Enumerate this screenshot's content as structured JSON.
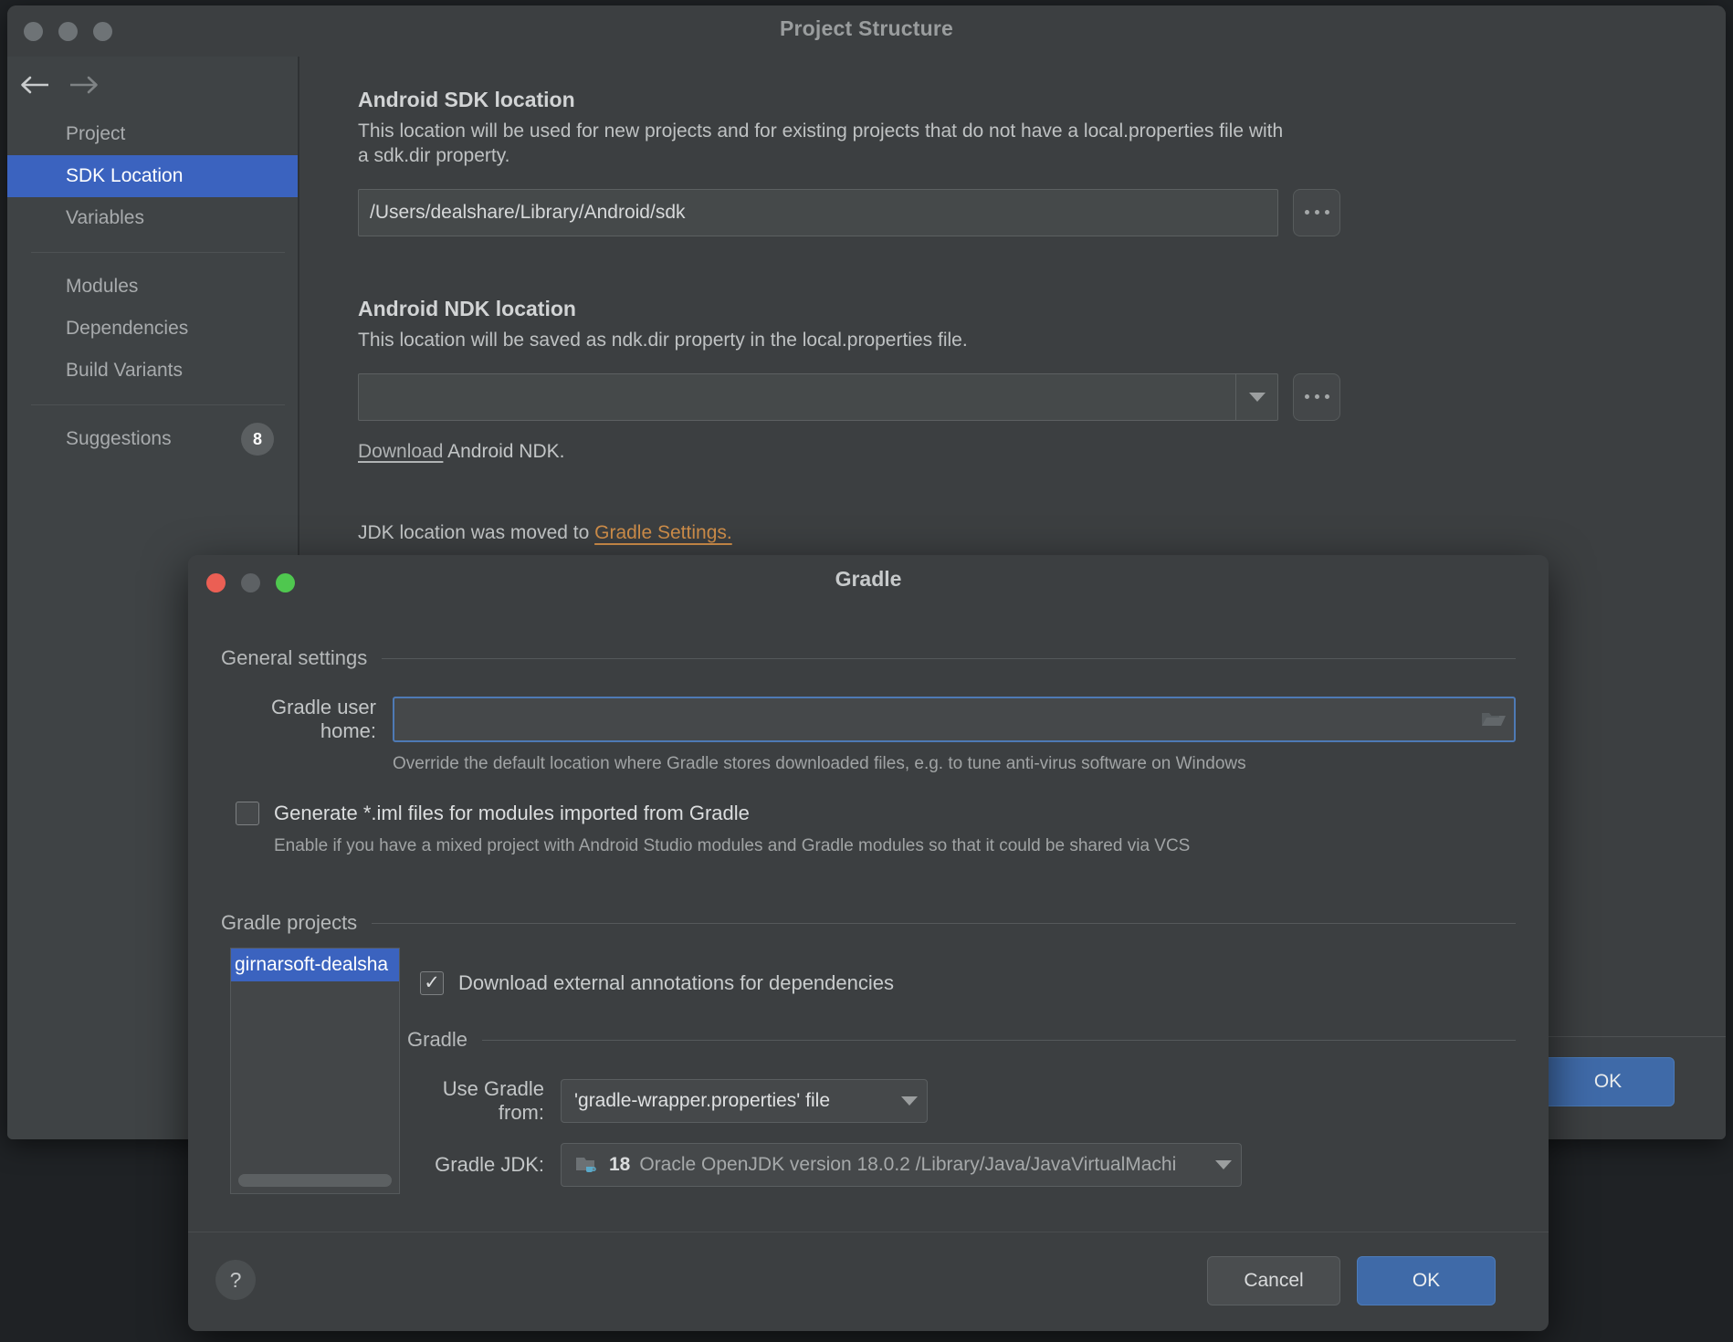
{
  "project_structure": {
    "title": "Project Structure",
    "sidebar": {
      "back_icon": "arrow-left-icon",
      "forward_icon": "arrow-right-icon",
      "items": [
        {
          "label": "Project",
          "selected": false
        },
        {
          "label": "SDK Location",
          "selected": true
        },
        {
          "label": "Variables",
          "selected": false
        },
        {
          "label": "Modules",
          "selected": false
        },
        {
          "label": "Dependencies",
          "selected": false
        },
        {
          "label": "Build Variants",
          "selected": false
        }
      ],
      "suggestions_label": "Suggestions",
      "suggestions_count": "8"
    },
    "sdk_section": {
      "title": "Android SDK location",
      "description": "This location will be used for new projects and for existing projects that do not have a local.properties file with a sdk.dir property.",
      "value": "/Users/dealshare/Library/Android/sdk",
      "browse_label": "...",
      "browse_icon": "ellipsis-icon"
    },
    "ndk_section": {
      "title": "Android NDK location",
      "description": "This location will be saved as ndk.dir property in the local.properties file.",
      "value": "",
      "dropdown_icon": "chevron-down-icon",
      "browse_label": "...",
      "browse_icon": "ellipsis-icon",
      "download_link": "Download",
      "download_suffix": " Android NDK."
    },
    "jdk_note": {
      "text": "JDK location was moved to ",
      "link": "Gradle Settings."
    },
    "ok_label": "OK"
  },
  "gradle_dialog": {
    "title": "Gradle",
    "general_settings": {
      "group_label": "General settings",
      "user_home_label": "Gradle user home:",
      "user_home_value": "",
      "user_home_browse_icon": "folder-icon",
      "user_home_hint": "Override the default location where Gradle stores downloaded files, e.g. to tune anti-virus software on Windows",
      "generate_iml_label": "Generate *.iml files for modules imported from Gradle",
      "generate_iml_checked": false,
      "generate_iml_hint": "Enable if you have a mixed project with Android Studio modules and Gradle modules so that it could be shared via VCS"
    },
    "gradle_projects": {
      "group_label": "Gradle projects",
      "items": [
        "girnarsoft-dealsha"
      ],
      "selected_index": 0,
      "download_annotations_label": "Download external annotations for dependencies",
      "download_annotations_checked": true,
      "scrollbar_icon": "horizontal-scrollbar"
    },
    "gradle_group": {
      "group_label": "Gradle",
      "use_gradle_from_label": "Use Gradle from:",
      "use_gradle_from_value": "'gradle-wrapper.properties' file",
      "gradle_jdk_label": "Gradle JDK:",
      "gradle_jdk_icon": "jdk-folder-icon",
      "gradle_jdk_version": "18",
      "gradle_jdk_value": "Oracle OpenJDK version 18.0.2 /Library/Java/JavaVirtualMachi",
      "dropdown_icon": "chevron-down-icon"
    },
    "help_label": "?",
    "cancel_label": "Cancel",
    "ok_label": "OK"
  },
  "colors": {
    "accent_blue": "#3b63bf",
    "button_blue": "#3f6aa8",
    "link_orange": "#cf8e4a",
    "window_bg": "#3c3f41",
    "sidebar_bg": "#3f4345"
  }
}
